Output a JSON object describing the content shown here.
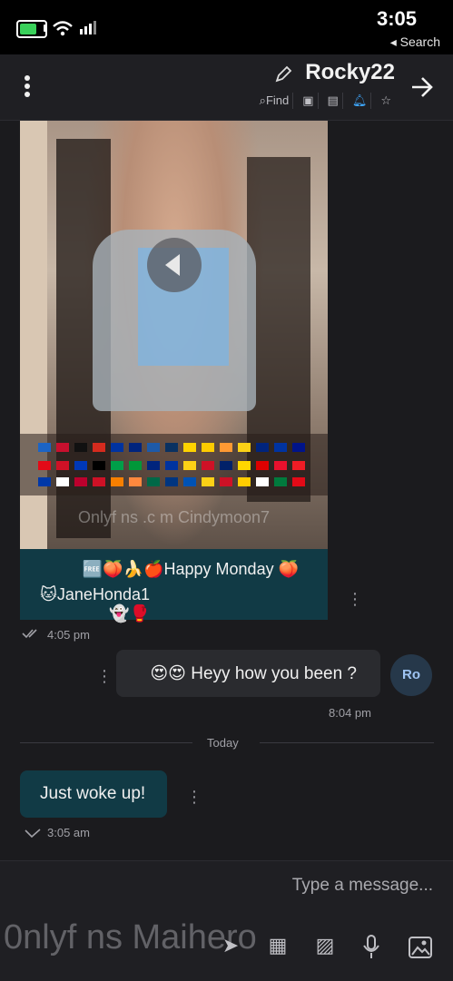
{
  "status_bar": {
    "time": "3:05",
    "back_label": "Search"
  },
  "header": {
    "contact_name": "Rocky22",
    "tabs": [
      "Find",
      "",
      "",
      "",
      ""
    ]
  },
  "media": {
    "watermark": "Onlyf ns .c m Cindymoon7",
    "caption_line1": "🆓🍑🍌🍎Happy Monday 🍑",
    "caption_line2": "🐱JaneHonda1👻🥊"
  },
  "messages": [
    {
      "time": "4:05 pm"
    },
    {
      "text": "😍😍 Heyy how you been ?",
      "time": "8:04 pm",
      "avatar": "Ro"
    },
    {
      "text": "Just woke up!",
      "time": "3:05 am"
    }
  ],
  "divider": {
    "label": "Today"
  },
  "composer": {
    "placeholder": "Type a message..."
  },
  "overlay_watermark": "0nlyf ns Maihero"
}
